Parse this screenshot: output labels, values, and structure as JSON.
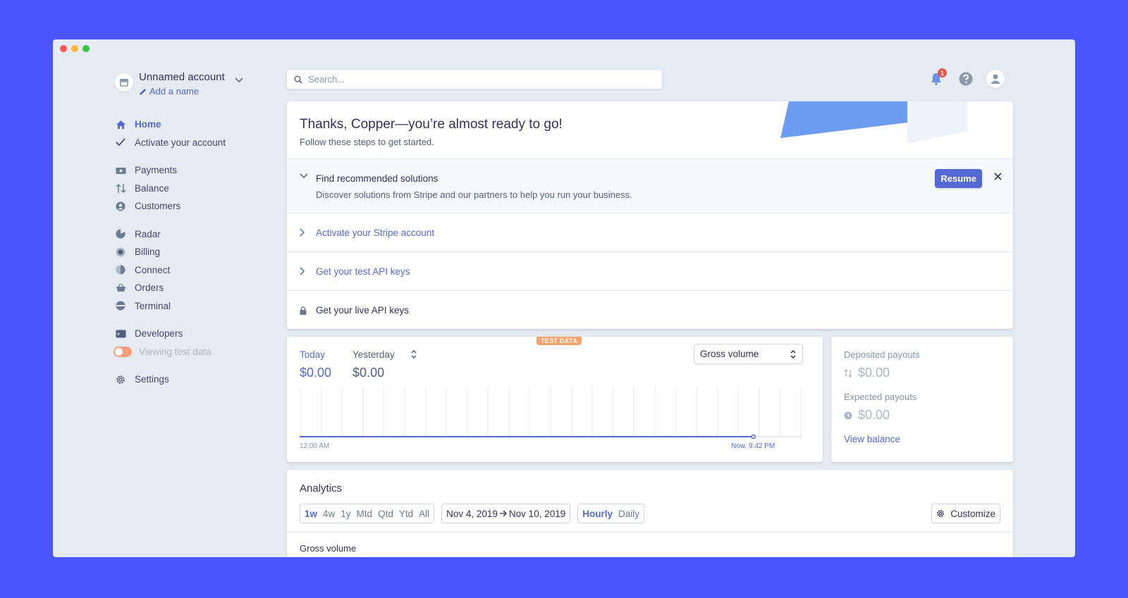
{
  "account": {
    "name": "Unnamed account",
    "add_name": "Add a name"
  },
  "nav": {
    "home": "Home",
    "activate": "Activate your account",
    "payments": "Payments",
    "balance": "Balance",
    "customers": "Customers",
    "radar": "Radar",
    "billing": "Billing",
    "connect": "Connect",
    "orders": "Orders",
    "terminal": "Terminal",
    "developers": "Developers",
    "test_data": "Viewing test data",
    "settings": "Settings"
  },
  "search": {
    "placeholder": "Search..."
  },
  "notifications": {
    "count": "1"
  },
  "onboarding": {
    "title": "Thanks, Copper—you’re almost ready to go!",
    "subtitle": "Follow these steps to get started.",
    "steps": [
      {
        "title": "Find recommended solutions",
        "desc": "Discover solutions from Stripe and our partners to help you run your business.",
        "action": "Resume"
      },
      {
        "title": "Activate your Stripe account"
      },
      {
        "title": "Get your test API keys"
      },
      {
        "title": "Get your live API keys"
      }
    ]
  },
  "volume": {
    "badge": "TEST DATA",
    "today_label": "Today",
    "today_value": "$0.00",
    "yesterday_label": "Yesterday",
    "yesterday_value": "$0.00",
    "metric": "Gross volume",
    "start_label": "12:00 AM",
    "end_label": "Now, 9:42 PM",
    "accent": "#5469d4"
  },
  "payouts": {
    "deposited_label": "Deposited payouts",
    "deposited_value": "$0.00",
    "expected_label": "Expected payouts",
    "expected_value": "$0.00",
    "link": "View balance"
  },
  "analytics": {
    "title": "Analytics",
    "ranges": [
      "1w",
      "4w",
      "1y",
      "Mtd",
      "Qtd",
      "Ytd",
      "All"
    ],
    "date_from": "Nov 4, 2019",
    "date_to": "Nov 10, 2019",
    "granularity": [
      "Hourly",
      "Daily"
    ],
    "customize": "Customize",
    "section": "Gross volume"
  }
}
